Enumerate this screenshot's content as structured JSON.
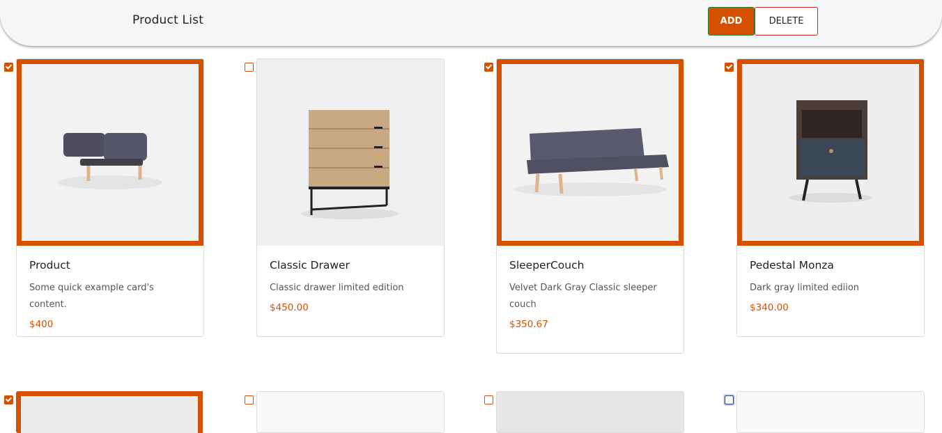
{
  "header": {
    "title": "Product List",
    "add_label": "ADD",
    "delete_label": "DELETE"
  },
  "accent_color": "#d55100",
  "products": [
    {
      "name": "Product",
      "description": "Some quick example card's content.",
      "price": "$400",
      "selected": true,
      "image": "folded-sofa-bed"
    },
    {
      "name": "Classic Drawer",
      "description": "Classic drawer limited edition",
      "price": "$450.00",
      "selected": false,
      "image": "wooden-chest-of-drawers"
    },
    {
      "name": "SleeperCouch",
      "description": "Velvet Dark Gray Classic sleeper couch",
      "price": "$350.67",
      "selected": true,
      "image": "gray-sleeper-couch"
    },
    {
      "name": "Pedestal Monza",
      "description": "Dark gray limited ediion",
      "price": "$340.00",
      "selected": true,
      "image": "bedside-pedestal"
    },
    {
      "selected": true,
      "image": "blank"
    },
    {
      "selected": false,
      "image": "blank"
    },
    {
      "selected": false,
      "image": "blank"
    },
    {
      "selected": false,
      "image": "blank"
    }
  ]
}
